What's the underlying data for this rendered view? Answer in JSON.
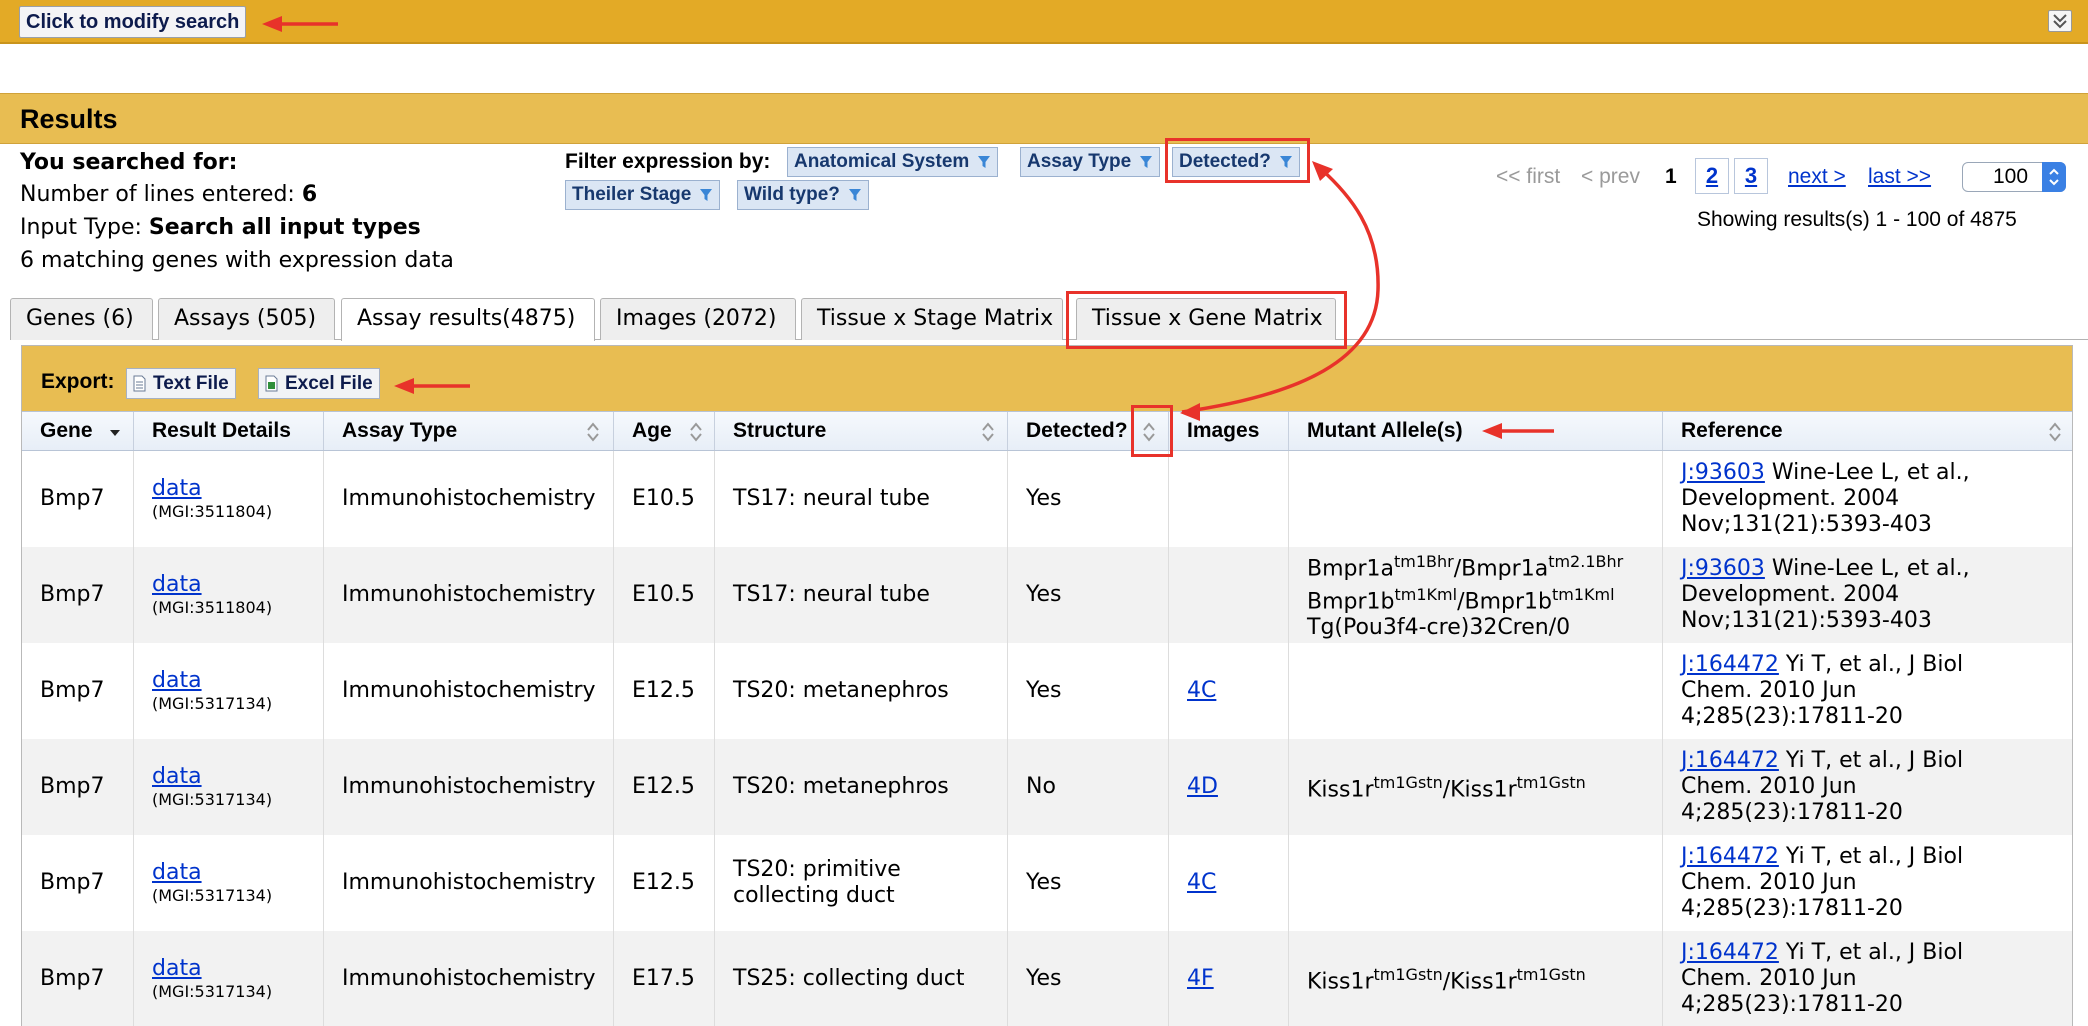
{
  "modify": {
    "button_label": "Click to modify search"
  },
  "results": {
    "title": "Results"
  },
  "summary": {
    "heading": "You searched for:",
    "lines_label": "Number of lines entered:",
    "lines_value": "6",
    "input_type_label": "Input Type:",
    "input_type_value": "Search all input types",
    "matching": "6 matching genes with expression data"
  },
  "filter": {
    "label": "Filter expression by:",
    "buttons": [
      "Anatomical System",
      "Assay Type",
      "Detected?",
      "Theiler Stage",
      "Wild type?"
    ]
  },
  "paging": {
    "first": "<< first",
    "prev": "< prev",
    "current": "1",
    "pages": [
      "2",
      "3"
    ],
    "next": "next >",
    "last": "last >>",
    "page_size": "100",
    "showing": "Showing results(s) 1 - 100 of 4875"
  },
  "tabs": [
    "Genes (6)",
    "Assays (505)",
    "Assay results(4875)",
    "Images (2072)",
    "Tissue x Stage Matrix",
    "Tissue x Gene Matrix"
  ],
  "active_tab": 2,
  "export": {
    "label": "Export:",
    "text_file": "Text File",
    "excel_file": "Excel File"
  },
  "columns": [
    "Gene",
    "Result Details",
    "Assay Type",
    "Age",
    "Structure",
    "Detected?",
    "Images",
    "Mutant Allele(s)",
    "Reference"
  ],
  "rows": [
    {
      "gene": "Bmp7",
      "details_link": "data",
      "mgi": "(MGI:3511804)",
      "assay": "Immunohistochemistry",
      "age": "E10.5",
      "structure": [
        "TS17: neural tube"
      ],
      "detected": "Yes",
      "image": "",
      "alleles": [],
      "ref_id": "J:93603",
      "ref_text_first": "Wine-Lee L, et al.,",
      "ref_lines": [
        "Development. 2004",
        "Nov;131(21):5393-403"
      ]
    },
    {
      "gene": "Bmp7",
      "details_link": "data",
      "mgi": "(MGI:3511804)",
      "assay": "Immunohistochemistry",
      "age": "E10.5",
      "structure": [
        "TS17: neural tube"
      ],
      "detected": "Yes",
      "image": "",
      "alleles": [
        [
          [
            "Bmpr1a",
            ""
          ],
          [
            "tm1Bhr",
            "sup"
          ],
          [
            "/Bmpr1a",
            ""
          ],
          [
            "tm2.1Bhr",
            "sup"
          ]
        ],
        [
          [
            "Bmpr1b",
            ""
          ],
          [
            "tm1Kml",
            "sup"
          ],
          [
            "/Bmpr1b",
            ""
          ],
          [
            "tm1Kml",
            "sup"
          ]
        ],
        [
          [
            "Tg(Pou3f4-cre)32Cren/0",
            ""
          ]
        ]
      ],
      "ref_id": "J:93603",
      "ref_text_first": "Wine-Lee L, et al.,",
      "ref_lines": [
        "Development. 2004",
        "Nov;131(21):5393-403"
      ]
    },
    {
      "gene": "Bmp7",
      "details_link": "data",
      "mgi": "(MGI:5317134)",
      "assay": "Immunohistochemistry",
      "age": "E12.5",
      "structure": [
        "TS20: metanephros"
      ],
      "detected": "Yes",
      "image": "4C",
      "alleles": [],
      "ref_id": "J:164472",
      "ref_text_first": "Yi T, et al., J Biol",
      "ref_lines": [
        "Chem. 2010 Jun",
        "4;285(23):17811-20"
      ]
    },
    {
      "gene": "Bmp7",
      "details_link": "data",
      "mgi": "(MGI:5317134)",
      "assay": "Immunohistochemistry",
      "age": "E12.5",
      "structure": [
        "TS20: metanephros"
      ],
      "detected": "No",
      "image": "4D",
      "alleles": [
        [
          [
            "Kiss1r",
            ""
          ],
          [
            "tm1Gstn",
            "sup"
          ],
          [
            "/Kiss1r",
            ""
          ],
          [
            "tm1Gstn",
            "sup"
          ]
        ]
      ],
      "ref_id": "J:164472",
      "ref_text_first": "Yi T, et al., J Biol",
      "ref_lines": [
        "Chem. 2010 Jun",
        "4;285(23):17811-20"
      ]
    },
    {
      "gene": "Bmp7",
      "details_link": "data",
      "mgi": "(MGI:5317134)",
      "assay": "Immunohistochemistry",
      "age": "E12.5",
      "structure": [
        "TS20: primitive",
        "collecting duct"
      ],
      "detected": "Yes",
      "image": "4C",
      "alleles": [],
      "ref_id": "J:164472",
      "ref_text_first": "Yi T, et al., J Biol",
      "ref_lines": [
        "Chem. 2010 Jun",
        "4;285(23):17811-20"
      ]
    },
    {
      "gene": "Bmp7",
      "details_link": "data",
      "mgi": "(MGI:5317134)",
      "assay": "Immunohistochemistry",
      "age": "E17.5",
      "structure": [
        "TS25: collecting duct"
      ],
      "detected": "Yes",
      "image": "4F",
      "alleles": [
        [
          [
            "Kiss1r",
            ""
          ],
          [
            "tm1Gstn",
            "sup"
          ],
          [
            "/Kiss1r",
            ""
          ],
          [
            "tm1Gstn",
            "sup"
          ]
        ]
      ],
      "ref_id": "J:164472",
      "ref_text_first": "Yi T, et al., J Biol",
      "ref_lines": [
        "Chem. 2010 Jun",
        "4;285(23):17811-20"
      ]
    }
  ],
  "colors": {
    "gold_bar": "#e3aa26",
    "results_bar": "#e8bd52",
    "link": "#0033cc",
    "annotation": "#e8322a"
  },
  "icons": [
    "collapse-icon",
    "funnel-icon",
    "sort-icon",
    "sort-desc-icon",
    "document-icon",
    "excel-icon",
    "arrow-icon"
  ]
}
